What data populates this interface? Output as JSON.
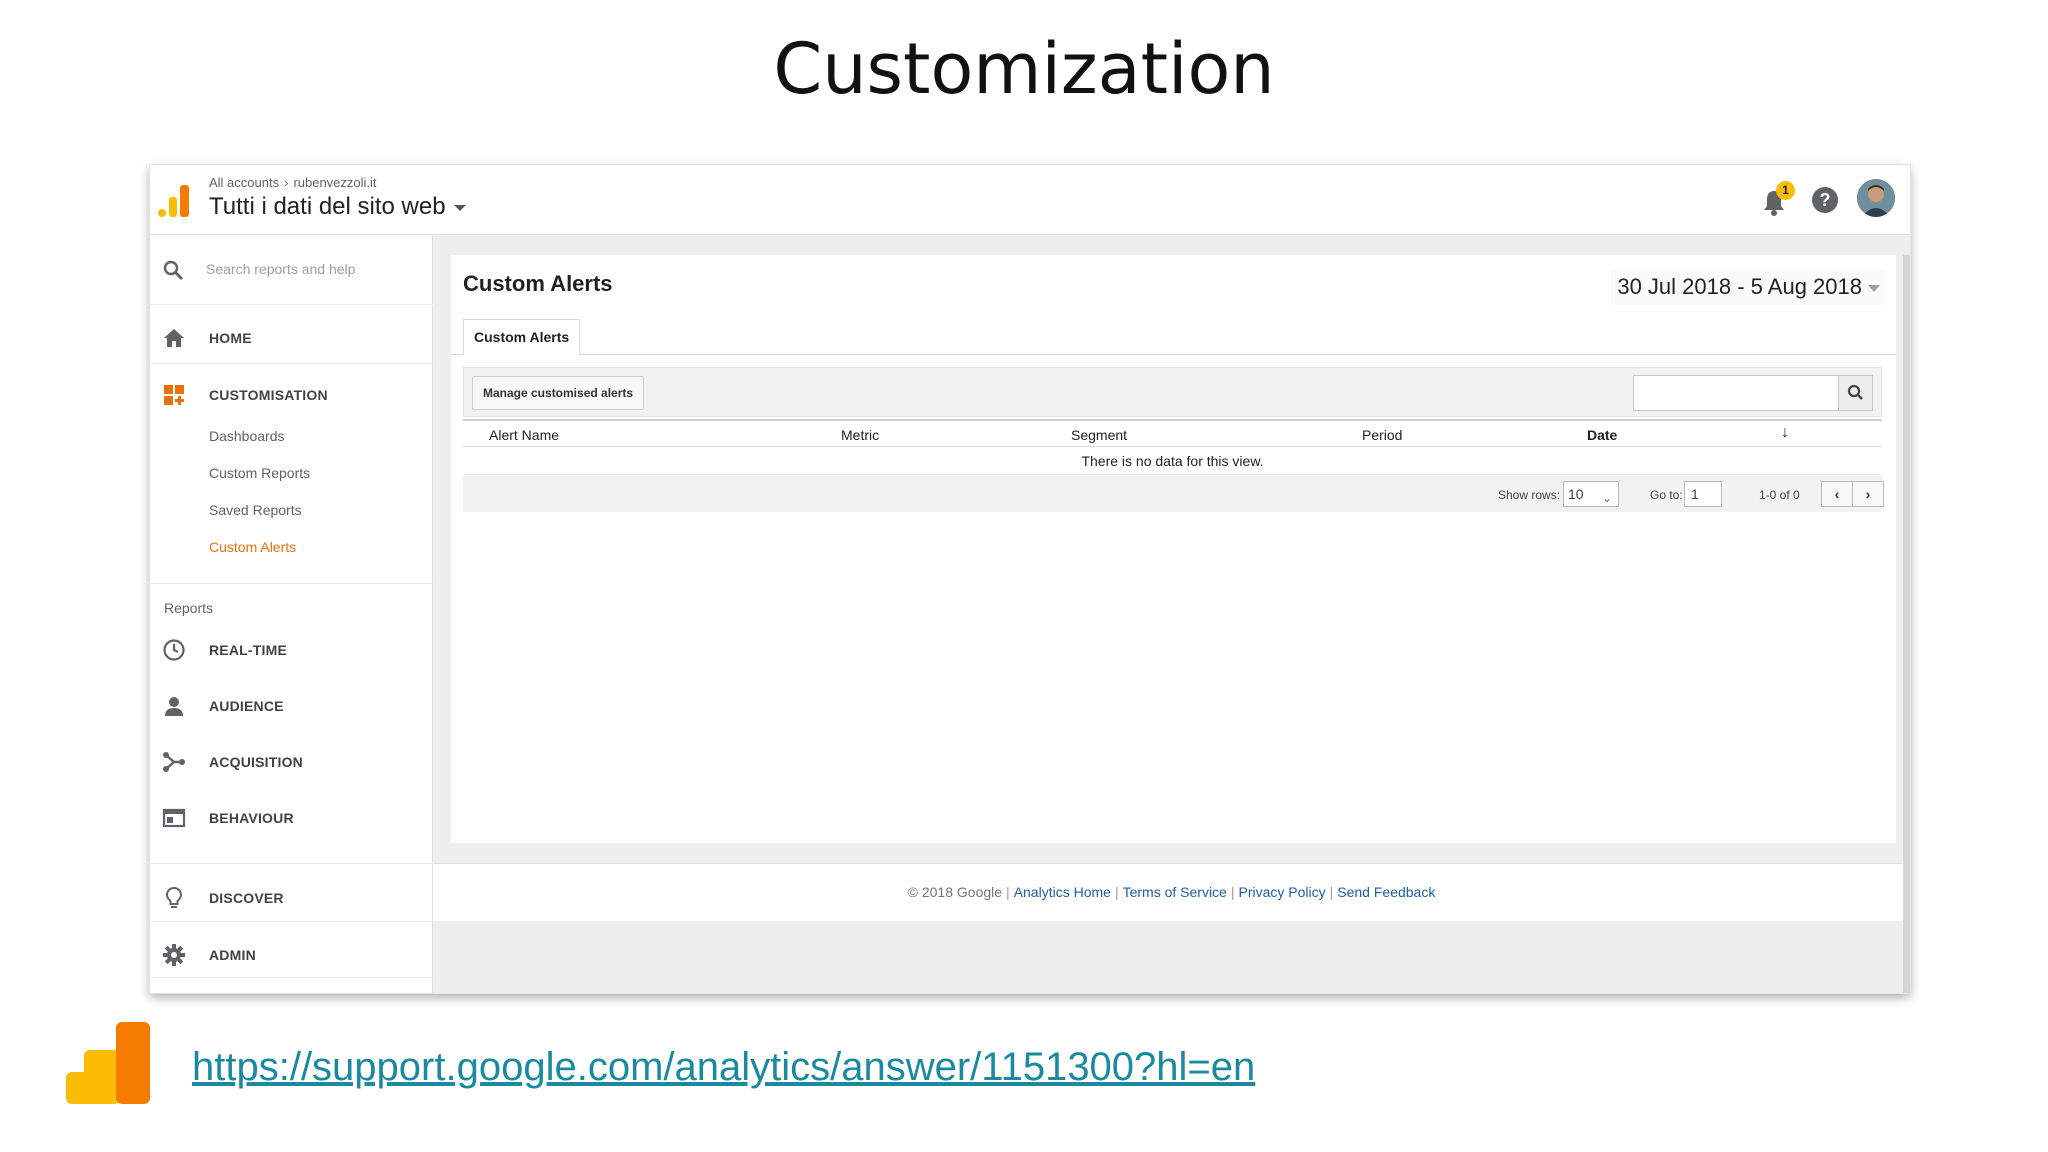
{
  "slide": {
    "title": "Customization",
    "url": "https://support.google.com/analytics/answer/1151300?hl=en"
  },
  "colors": {
    "accent": "#e8710a",
    "logo_yellow": "#fbbc04",
    "logo_orange": "#f57c00",
    "link": "#1a5fa8",
    "url": "#1a8aa0"
  },
  "header": {
    "breadcrumb_all": "All accounts",
    "breadcrumb_site": "rubenvezzoli.it",
    "property": "Tutti i dati del sito web",
    "notification_count": "1",
    "help_glyph": "?"
  },
  "sidebar": {
    "search_placeholder": "Search reports and help",
    "home": "HOME",
    "customisation": "CUSTOMISATION",
    "sub_items": [
      "Dashboards",
      "Custom Reports",
      "Saved Reports",
      "Custom Alerts"
    ],
    "active_sub_item": "Custom Alerts",
    "reports_label": "Reports",
    "reports": [
      "REAL-TIME",
      "AUDIENCE",
      "ACQUISITION",
      "BEHAVIOUR"
    ],
    "discover": "DISCOVER",
    "admin": "ADMIN"
  },
  "main": {
    "title": "Custom Alerts",
    "date_range": "30 Jul 2018 - 5 Aug 2018",
    "tab": "Custom Alerts",
    "manage_button": "Manage customised alerts",
    "columns": [
      "Alert Name",
      "Metric",
      "Segment",
      "Period",
      "Date"
    ],
    "sorted_column": "Date",
    "sort_glyph": "↓",
    "empty_message": "There is no data for this view.",
    "pager": {
      "show_rows_label": "Show rows:",
      "show_rows_value": "10",
      "goto_label": "Go to:",
      "goto_value": "1",
      "range": "1-0 of 0",
      "prev": "‹",
      "next": "›"
    }
  },
  "footer": {
    "copyright": "© 2018 Google",
    "links": [
      "Analytics Home",
      "Terms of Service",
      "Privacy Policy",
      "Send Feedback"
    ]
  }
}
